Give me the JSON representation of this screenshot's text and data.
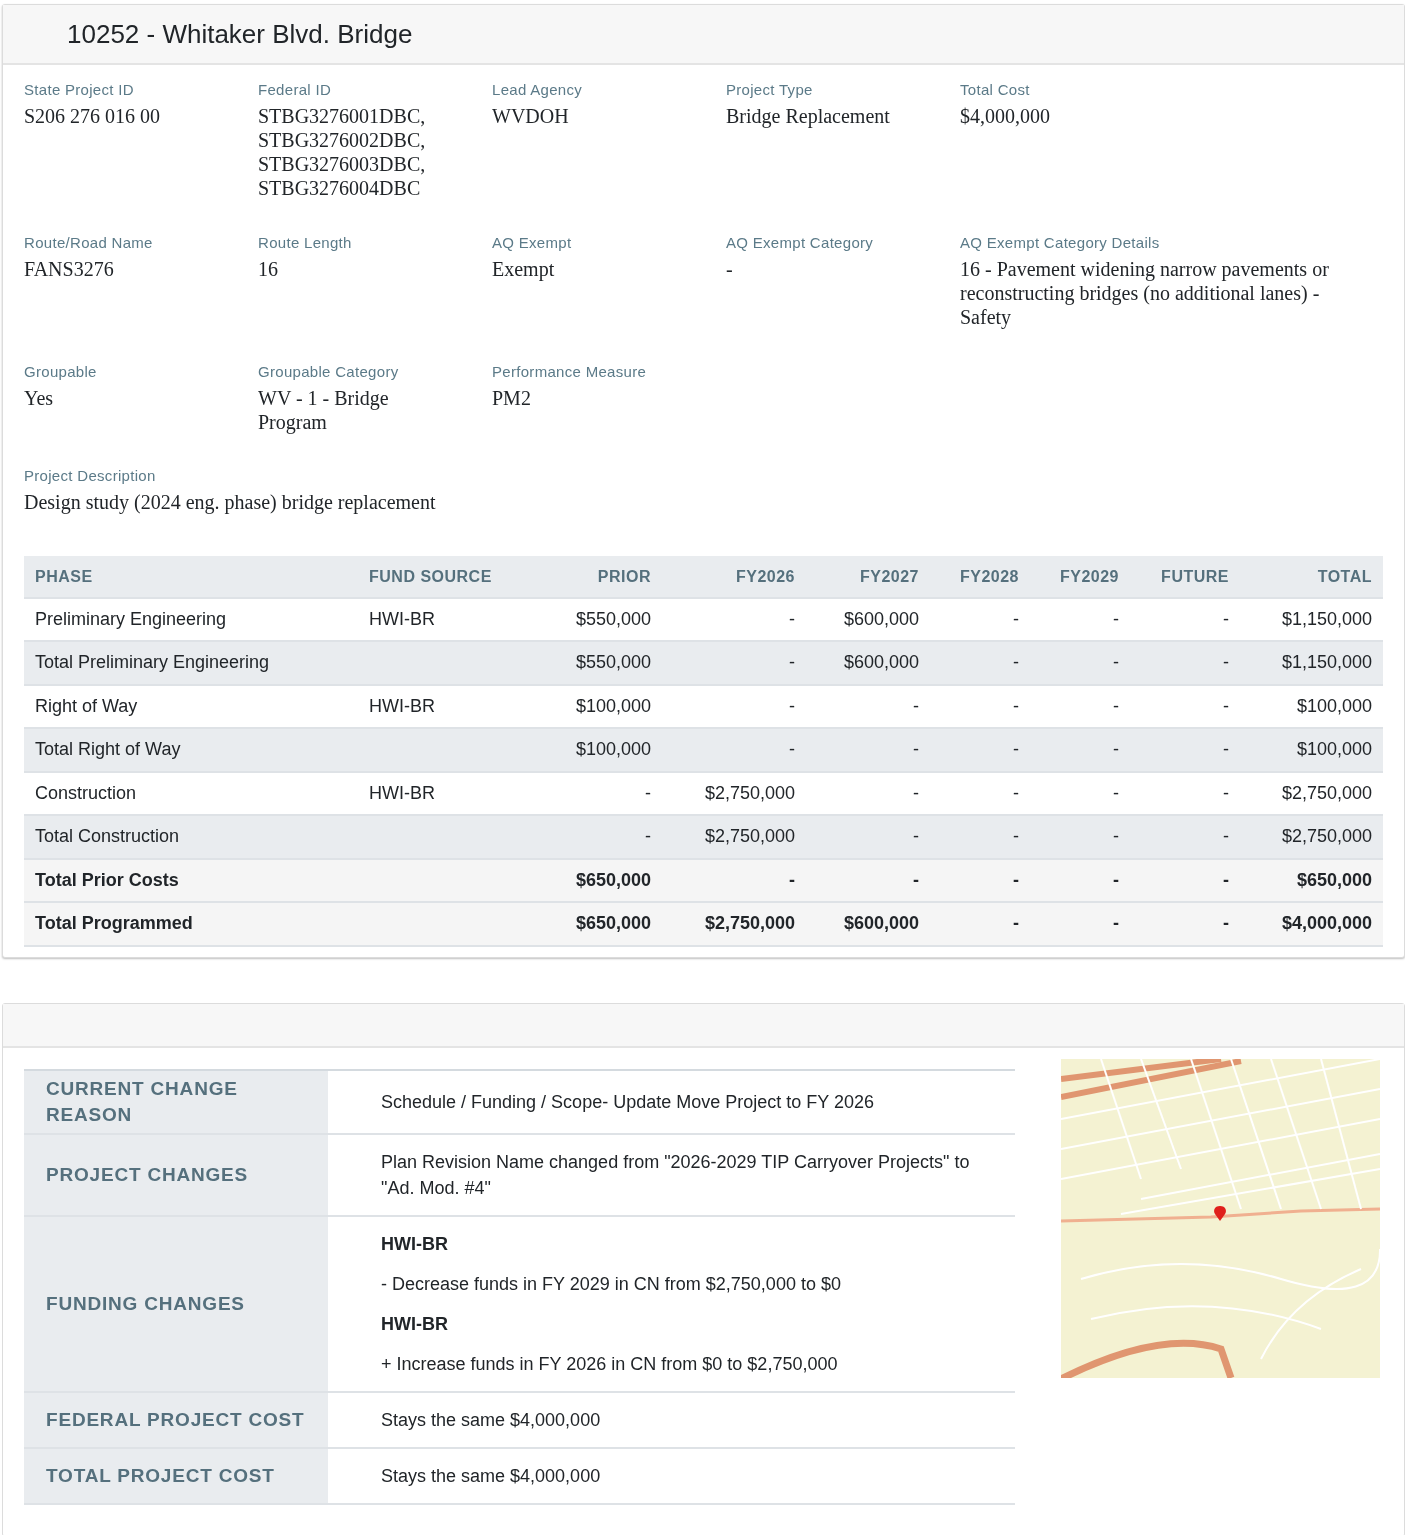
{
  "project": {
    "title": "10252 - Whitaker Blvd. Bridge",
    "fields": [
      {
        "label": "State Project ID",
        "value": "S206 276 016 00"
      },
      {
        "label": "Federal ID",
        "value": "STBG3276001DBC, STBG3276002DBC, STBG3276003DBC, STBG3276004DBC"
      },
      {
        "label": "Lead Agency",
        "value": "WVDOH"
      },
      {
        "label": "Project Type",
        "value": "Bridge Replacement"
      },
      {
        "label": "Total Cost",
        "value": "$4,000,000"
      },
      {
        "label": "Route/Road Name",
        "value": "FANS3276"
      },
      {
        "label": "Route Length",
        "value": "16"
      },
      {
        "label": "AQ Exempt",
        "value": "Exempt"
      },
      {
        "label": "AQ Exempt Category",
        "value": "-"
      },
      {
        "label": "AQ Exempt Category Details",
        "value": "16 - Pavement widening narrow pavements or reconstructing bridges (no additional lanes) - Safety"
      },
      {
        "label": "Groupable",
        "value": "Yes"
      },
      {
        "label": "Groupable Category",
        "value": "WV - 1 - Bridge Program"
      },
      {
        "label": "Performance Measure",
        "value": "PM2"
      }
    ],
    "description": {
      "label": "Project Description",
      "value": "Design study (2024 eng. phase) bridge replacement"
    },
    "funding_table": {
      "columns": [
        "PHASE",
        "FUND SOURCE",
        "PRIOR",
        "FY2026",
        "FY2027",
        "FY2028",
        "FY2029",
        "FUTURE",
        "TOTAL"
      ],
      "rows": [
        {
          "kind": "detail",
          "cells": [
            "Preliminary Engineering",
            "HWI-BR",
            "$550,000",
            "-",
            "$600,000",
            "-",
            "-",
            "-",
            "$1,150,000"
          ]
        },
        {
          "kind": "subtotal",
          "cells": [
            "Total Preliminary Engineering",
            "",
            "$550,000",
            "-",
            "$600,000",
            "-",
            "-",
            "-",
            "$1,150,000"
          ]
        },
        {
          "kind": "detail",
          "cells": [
            "Right of Way",
            "HWI-BR",
            "$100,000",
            "-",
            "-",
            "-",
            "-",
            "-",
            "$100,000"
          ]
        },
        {
          "kind": "subtotal",
          "cells": [
            "Total Right of Way",
            "",
            "$100,000",
            "-",
            "-",
            "-",
            "-",
            "-",
            "$100,000"
          ]
        },
        {
          "kind": "detail",
          "cells": [
            "Construction",
            "HWI-BR",
            "-",
            "$2,750,000",
            "-",
            "-",
            "-",
            "-",
            "$2,750,000"
          ]
        },
        {
          "kind": "subtotal",
          "cells": [
            "Total Construction",
            "",
            "-",
            "$2,750,000",
            "-",
            "-",
            "-",
            "-",
            "$2,750,000"
          ]
        },
        {
          "kind": "grand",
          "cells": [
            "Total Prior Costs",
            "",
            "$650,000",
            "-",
            "-",
            "-",
            "-",
            "-",
            "$650,000"
          ]
        },
        {
          "kind": "grand",
          "cells": [
            "Total Programmed",
            "",
            "$650,000",
            "$2,750,000",
            "$600,000",
            "-",
            "-",
            "-",
            "$4,000,000"
          ]
        }
      ]
    }
  },
  "changes": {
    "rows": [
      {
        "label": "CURRENT CHANGE REASON",
        "lines": [
          {
            "kind": "text",
            "text": "Schedule / Funding / Scope- Update Move Project to FY 2026"
          }
        ]
      },
      {
        "label": "PROJECT CHANGES",
        "lines": [
          {
            "kind": "text",
            "text": "Plan Revision Name changed from \"2026-2029 TIP Carryover Projects\" to \"Ad. Mod. #4\""
          }
        ]
      },
      {
        "label": "FUNDING CHANGES",
        "lines": [
          {
            "kind": "heading",
            "text": "HWI-BR"
          },
          {
            "kind": "text",
            "text": "- Decrease funds in FY 2029 in CN from $2,750,000 to $0"
          },
          {
            "kind": "heading",
            "text": "HWI-BR"
          },
          {
            "kind": "text",
            "text": "+ Increase funds in FY 2026 in CN from $0 to $2,750,000"
          }
        ]
      },
      {
        "label": "FEDERAL PROJECT COST",
        "lines": [
          {
            "kind": "text",
            "text": "Stays the same $4,000,000"
          }
        ]
      },
      {
        "label": "TOTAL PROJECT COST",
        "lines": [
          {
            "kind": "text",
            "text": "Stays the same $4,000,000"
          }
        ]
      }
    ]
  }
}
